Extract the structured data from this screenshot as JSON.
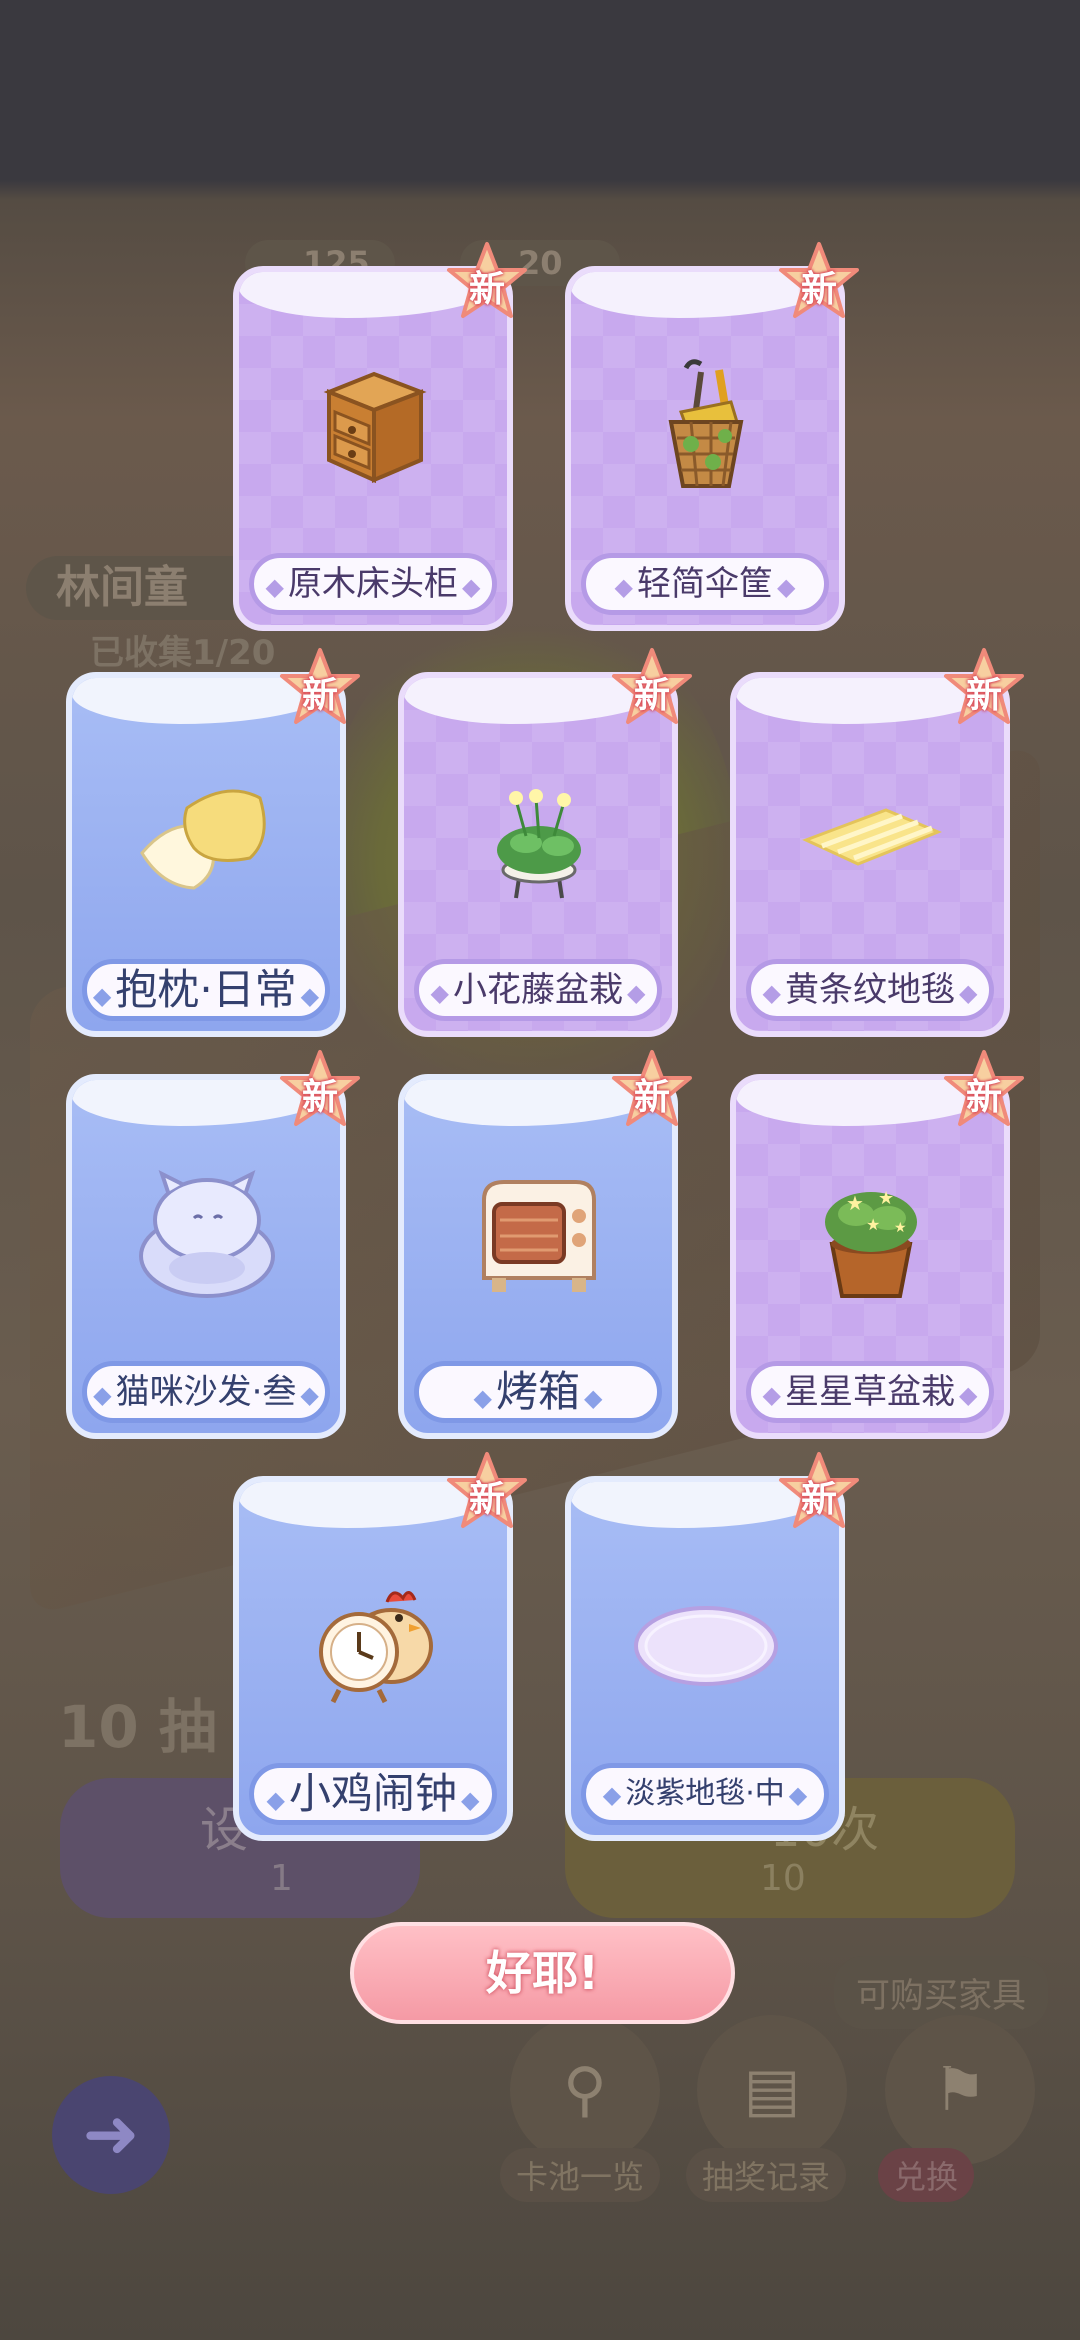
{
  "background": {
    "resource_1": "125",
    "resource_2": "20",
    "set_name": "林间童",
    "collection_progress": "已收集1/20",
    "draw_ten_label": "10 抽",
    "draw_once_button": "设",
    "draw_once_cost": "1",
    "draw_ten_button": "10次",
    "draw_ten_cost": "10",
    "shop_hint": "可购买家具",
    "nav": [
      {
        "label": "卡池一览",
        "icon": "magnifier-icon"
      },
      {
        "label": "抽奖记录",
        "icon": "record-book-icon"
      },
      {
        "label": "兑换",
        "icon": "shopping-bag-icon"
      }
    ],
    "back_icon": "back-arrow-icon"
  },
  "new_badge": "新",
  "diamond": "◆",
  "cards": [
    {
      "name": "原木床头柜",
      "style": "purple",
      "icon": "nightstand-icon"
    },
    {
      "name": "轻简伞筐",
      "style": "purple",
      "icon": "umbrella-basket-icon"
    },
    {
      "name": "抱枕·日常",
      "style": "blue",
      "icon": "pillow-icon"
    },
    {
      "name": "小花藤盆栽",
      "style": "purple",
      "icon": "flower-vine-pot-icon"
    },
    {
      "name": "黄条纹地毯",
      "style": "purple",
      "icon": "yellow-stripe-rug-icon"
    },
    {
      "name": "猫咪沙发·叁",
      "style": "blue",
      "icon": "cat-sofa-icon"
    },
    {
      "name": "烤箱",
      "style": "blue",
      "icon": "oven-icon"
    },
    {
      "name": "星星草盆栽",
      "style": "purple",
      "icon": "star-grass-pot-icon"
    },
    {
      "name": "小鸡闹钟",
      "style": "blue",
      "icon": "chicken-clock-icon"
    },
    {
      "name": "淡紫地毯·中",
      "style": "blue",
      "icon": "lavender-rug-icon"
    }
  ],
  "confirm_button": "好耶!",
  "colors": {
    "purple_card": "#c8a9ee",
    "blue_card": "#96adf0",
    "confirm_pink": "#f7a3ad",
    "badge_red": "#f0606e"
  }
}
